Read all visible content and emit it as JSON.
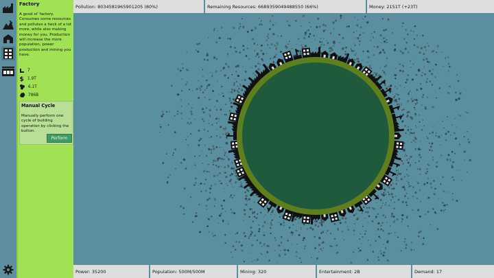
{
  "top_bar": {
    "pollution": "Pollution: 8034581965901205 (80%)",
    "remaining_resources": "Remaining Resources: 6689359049488550 (66%)",
    "money": "Money: 2151T (+23T)"
  },
  "bottom_bar": {
    "power": "Power: 35200",
    "population": "Population: 500M/500M",
    "mining": "Mining: 320",
    "entertainment": "Entertainment: 2B",
    "demand": "Demand: 17"
  },
  "building_panel": {
    "title": "Factory",
    "description": "A good ol' factory. Consumes some resources and pollutes a heck of a lot more, while also making money for you. Production will increase the more population, power production and mining you have.",
    "stats": [
      {
        "icon": "worker-icon",
        "value": "7"
      },
      {
        "icon": "dollar-icon",
        "value": "1.9T"
      },
      {
        "icon": "pollution-icon",
        "value": "6.1T"
      },
      {
        "icon": "resource-icon",
        "value": "786B"
      }
    ]
  },
  "manual_cycle": {
    "title": "Manual Cycle",
    "description": "Manually perform one cycle of building operation by clicking the button.",
    "button_label": "Perform"
  },
  "rail_icons": [
    "factory-icon",
    "mine-icon",
    "building-icon",
    "office-icon",
    "power-icon",
    "settings-gear-icon"
  ],
  "colors": {
    "background": "#5a8fa0",
    "panel": "#a1e254",
    "bars": "#dedede",
    "planet_ring": "#5f7f1f",
    "planet_core": "#1f5a3c",
    "perform_button": "#3f9a63"
  }
}
